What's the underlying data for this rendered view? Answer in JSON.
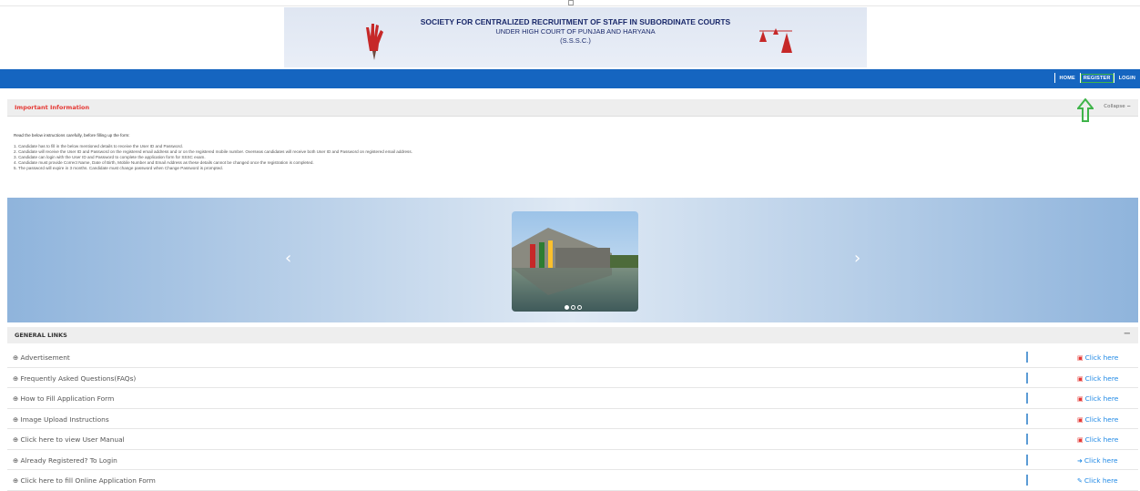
{
  "banner": {
    "line1": "SOCIETY FOR CENTRALIZED RECRUITMENT OF STAFF IN SUBORDINATE COURTS",
    "line2": "UNDER HIGH COURT OF PUNJAB AND HARYANA",
    "line3": "(S.S.S.C.)"
  },
  "nav": {
    "home": "HOME",
    "register": "REGISTER",
    "login": "LOGIN"
  },
  "info": {
    "title": "Important Information",
    "collapse": "Collapse",
    "lead": "Read the below instructions carefully, before filling up the form:",
    "items": [
      "1. Candidate has to fill in the below mentioned details to receive the User ID and Password.",
      "2. Candidate will receive the User ID and Password on the registered email address and or on the registered mobile number. Overseas candidates will receive both User ID and Password on registered email address.",
      "3. Candidate can login with the User ID and Password to complete the application form for SSSC exam.",
      "4. Candidate must provide Correct Name, Date of Birth, Mobile Number and Email Address as these details cannot be changed once the registration is completed.",
      "5. The password will expire in 3 months. Candidate must change password when Change Password is prompted."
    ]
  },
  "carousel": {
    "prev": "‹",
    "next": "›",
    "active_index": 0,
    "slide_count": 3
  },
  "general_links": {
    "title": "GENERAL LINKS",
    "toggle": "−",
    "rows": [
      {
        "label": "Advertisement",
        "action": "Click here",
        "icon": "pdf-icon"
      },
      {
        "label": "Frequently Asked Questions(FAQs)",
        "action": "Click here",
        "icon": "pdf-icon"
      },
      {
        "label": "How to Fill Application Form",
        "action": "Click here",
        "icon": "pdf-icon"
      },
      {
        "label": "Image Upload Instructions",
        "action": "Click here",
        "icon": "pdf-icon"
      },
      {
        "label": "Click here to view User Manual",
        "action": "Click here",
        "icon": "pdf-icon"
      },
      {
        "label": "Already Registered? To Login",
        "action": "Click here",
        "icon": "sign-in-icon"
      },
      {
        "label": "Click here to fill Online Application Form",
        "action": "Click here",
        "icon": "edit-icon"
      }
    ]
  },
  "colors": {
    "navbar": "#1565c0",
    "title_red": "#e53935",
    "link_blue": "#1e88e5",
    "highlight_green": "#3fb44a"
  }
}
